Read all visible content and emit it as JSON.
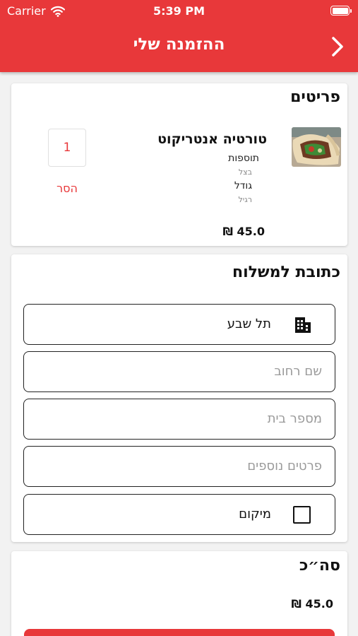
{
  "status_bar": {
    "carrier": "Carrier",
    "time": "5:39 PM"
  },
  "header": {
    "title": "ההזמנה שלי",
    "accent_color": "#e8383a"
  },
  "items_section": {
    "title": "פריטים",
    "item": {
      "name": "טורטיה אנטריקוט",
      "addons_label": "תוספות",
      "addons_value": "בצל",
      "size_label": "גודל",
      "size_value": "רגיל",
      "quantity": "1",
      "remove_label": "הסר",
      "price": "45.0 ₪"
    }
  },
  "address_section": {
    "title": "כתובת למשלוח",
    "city_value": "תל שבע",
    "street_placeholder": "שם רחוב",
    "house_number_placeholder": "מספר בית",
    "details_placeholder": "פרטים נוספים",
    "location_label": "מיקום",
    "icons": {
      "city": "building-icon"
    }
  },
  "total_section": {
    "title": "סה״כ",
    "amount": "45.0 ₪"
  }
}
